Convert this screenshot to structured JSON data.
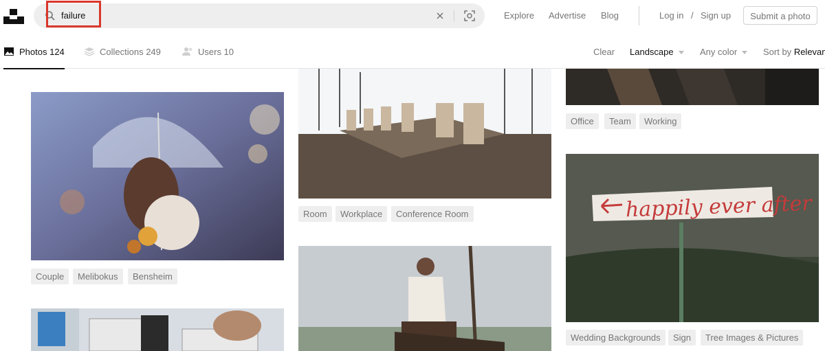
{
  "search": {
    "value": "failure"
  },
  "header": {
    "nav": [
      "Explore",
      "Advertise",
      "Blog"
    ],
    "login": "Log in",
    "separator": "/",
    "signup": "Sign up",
    "submit": "Submit a photo"
  },
  "tabs": [
    {
      "label": "Photos 124",
      "icon": "photo-icon"
    },
    {
      "label": "Collections 249",
      "icon": "collections-icon"
    },
    {
      "label": "Users 10",
      "icon": "users-icon"
    }
  ],
  "filters": {
    "clear": "Clear",
    "orientation": "Landscape",
    "color": "Any color",
    "sort_prefix": "Sort by",
    "sort_value": "Relevan"
  },
  "photos": {
    "umbrella": {
      "tags": [
        "Couple",
        "Melibokus",
        "Bensheim"
      ]
    },
    "conference": {
      "tags": [
        "Room",
        "Workplace",
        "Conference Room"
      ]
    },
    "office": {
      "tags": [
        "Office",
        "Team",
        "Working"
      ]
    },
    "sign": {
      "text": "happily ever after",
      "tags": [
        "Wedding Backgrounds",
        "Sign",
        "Tree Images & Pictures"
      ]
    }
  },
  "colors": {
    "highlight": "#d9372b",
    "tag_bg": "#eeeeee",
    "muted": "#767676"
  }
}
